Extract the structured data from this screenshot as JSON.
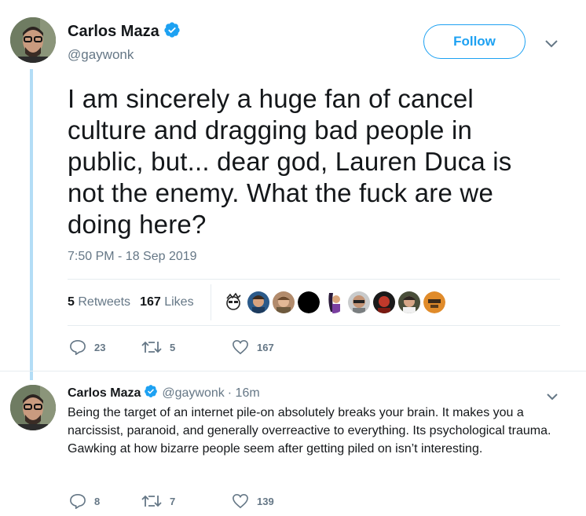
{
  "main_tweet": {
    "author_name": "Carlos Maza",
    "author_handle": "@gaywonk",
    "follow_label": "Follow",
    "text": "I am sincerely a huge fan of cancel culture and dragging bad people in public, but... dear god, Lauren Duca is not the enemy. What the fuck are we doing here?",
    "timestamp": "7:50 PM - 18 Sep 2019",
    "retweets_count": "5",
    "retweets_label": "Retweets",
    "likes_count": "167",
    "likes_label": "Likes",
    "actions": {
      "replies": "23",
      "retweets": "5",
      "likes": "167"
    }
  },
  "reply_tweet": {
    "author_name": "Carlos Maza",
    "author_handle": "@gaywonk",
    "time_ago": "· 16m",
    "text": "Being the target of an internet pile-on absolutely breaks your brain. It makes you a narcissist, paranoid, and generally overreactive to everything. Its psychological trauma. Gawking at how bizarre people seem after getting piled on isn’t interesting.",
    "actions": {
      "replies": "8",
      "retweets": "7",
      "likes": "139"
    }
  },
  "colors": {
    "accent": "#1da1f2",
    "thread_line": "#b3ddf6",
    "muted": "#657786",
    "divider": "#e6ecf0"
  }
}
